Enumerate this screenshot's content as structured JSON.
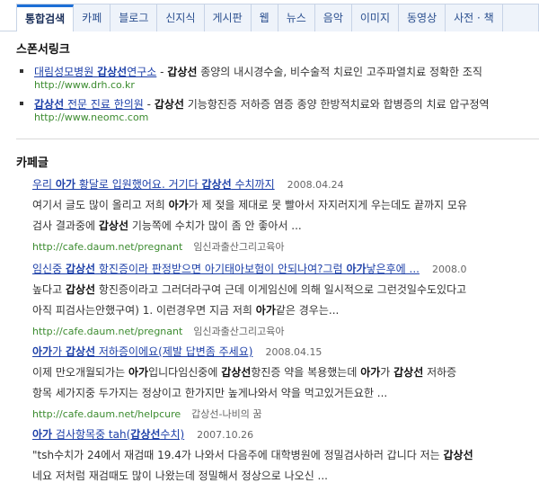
{
  "tabs": [
    {
      "label": "통합검색",
      "active": true
    },
    {
      "label": "카페",
      "active": false
    },
    {
      "label": "블로그",
      "active": false
    },
    {
      "label": "신지식",
      "active": false
    },
    {
      "label": "게시판",
      "active": false
    },
    {
      "label": "웹",
      "active": false
    },
    {
      "label": "뉴스",
      "active": false
    },
    {
      "label": "음악",
      "active": false
    },
    {
      "label": "이미지",
      "active": false
    },
    {
      "label": "동영상",
      "active": false
    },
    {
      "label": "사전 · 책",
      "active": false
    }
  ],
  "sponsor": {
    "title": "스폰서링크",
    "items": [
      {
        "link_pre": "대림성모병원 ",
        "link_bold": "갑상선",
        "link_post": "연구소",
        "dash": " - ",
        "desc_bold": "갑상선",
        "desc": " 종양의 내시경수술, 비수술적 치료인 고주파열치료 정확한 조직",
        "url": "http://www.drh.co.kr"
      },
      {
        "link_pre": "",
        "link_bold": "갑상선",
        "link_post": " 전문 진료 한의원",
        "dash": " - ",
        "desc_bold": "갑상선",
        "desc": " 기능항진증 저하증 염증 종양 한방적치료와 합병증의 치료 압구정역",
        "url": "http://www.neomc.com"
      }
    ]
  },
  "cafe": {
    "title": "카페글",
    "results": [
      {
        "title": [
          {
            "t": "우리 "
          },
          {
            "t": "아가",
            "b": true
          },
          {
            "t": " 황달로 입원했어요. 거기다 "
          },
          {
            "t": "갑상선",
            "b": true
          },
          {
            "t": " 수치까지"
          }
        ],
        "date": "2008.04.24",
        "line1": [
          {
            "t": "여기서 글도 많이 올리고 저희 "
          },
          {
            "t": "아가",
            "b": true
          },
          {
            "t": "가 제 젖을 제대로 못 빨아서 자지러지게 우는데도 끝까지 모유"
          }
        ],
        "line2": [
          {
            "t": "검사 결과중에 "
          },
          {
            "t": "갑상선",
            "b": true
          },
          {
            "t": " 기능쪽에 수치가 많이 좀 안 좋아서 ..."
          }
        ],
        "url": "http://cafe.daum.net/pregnant",
        "cafe": "임신과출산그리고육아"
      },
      {
        "title": [
          {
            "t": "임신중 "
          },
          {
            "t": "갑상선",
            "b": true
          },
          {
            "t": " 항진증이라 판정받으면 아기태아보험이 안되나여?그럼 "
          },
          {
            "t": "아가",
            "b": true
          },
          {
            "t": "낳은후에 ..."
          }
        ],
        "date": "2008.0",
        "line1": [
          {
            "t": "높다고 "
          },
          {
            "t": "갑상선",
            "b": true
          },
          {
            "t": " 항진증이라고 그러더라구여 근데 이게임신에 의해 일시적으로 그런것일수도있다고"
          }
        ],
        "line2": [
          {
            "t": "아직 피검사는안했구여) 1. 이런경우면 지금 저희 "
          },
          {
            "t": "아가",
            "b": true
          },
          {
            "t": "같은 경우는..."
          }
        ],
        "url": "http://cafe.daum.net/pregnant",
        "cafe": "임신과출산그리고육아"
      },
      {
        "title": [
          {
            "t": "아가",
            "b": true
          },
          {
            "t": "가 "
          },
          {
            "t": "갑상선",
            "b": true
          },
          {
            "t": " 저하증이에요(제발 답변좀 주세요)"
          }
        ],
        "date": "2008.04.15",
        "line1": [
          {
            "t": "이제 만오개월되가는 "
          },
          {
            "t": "아가",
            "b": true
          },
          {
            "t": "입니다임신중에 "
          },
          {
            "t": "갑상선",
            "b": true
          },
          {
            "t": "항진증 약을 복용했는데 "
          },
          {
            "t": "아가",
            "b": true
          },
          {
            "t": "가 "
          },
          {
            "t": "갑상선",
            "b": true
          },
          {
            "t": " 저하증"
          }
        ],
        "line2": [
          {
            "t": "항목 세가지중 두가지는 정상이고 한가지만 높게나와서 약을 먹고있거든요한 ..."
          }
        ],
        "url": "http://cafe.daum.net/helpcure",
        "cafe": "갑상선-나비의 꿈"
      },
      {
        "title": [
          {
            "t": "아가",
            "b": true
          },
          {
            "t": " 검사항목중 tah("
          },
          {
            "t": "갑상선",
            "b": true
          },
          {
            "t": "수치)"
          }
        ],
        "date": "2007.10.26",
        "line1": [
          {
            "t": "\"tsh수치가 24에서 재검때 19.4가 나와서 다음주에 대학병원에 정밀검사하러 갑니다 저는 "
          },
          {
            "t": "갑상선",
            "b": true
          }
        ],
        "line2": [
          {
            "t": "네요 저처럼 재검때도 많이 나왔는데 정밀해서 정상으로 나오신 ..."
          }
        ],
        "url": "",
        "cafe": ""
      }
    ]
  }
}
